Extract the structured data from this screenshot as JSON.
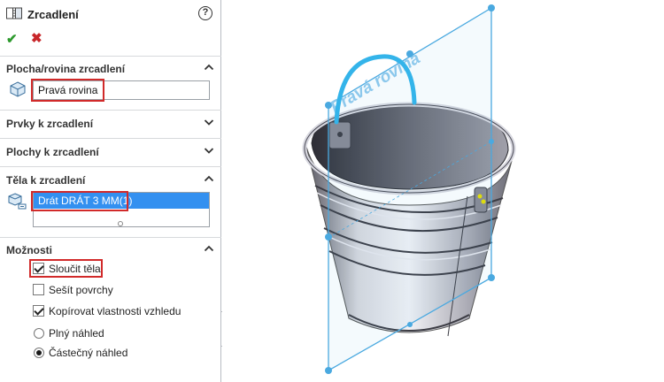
{
  "feature": {
    "title": "Zrcadlení",
    "help_glyph": "?",
    "ok_glyph": "✔",
    "cancel_glyph": "✖"
  },
  "sections": {
    "mirror_plane": {
      "label": "Plocha/rovina zrcadlení",
      "state": "expanded",
      "value": "Pravá rovina"
    },
    "features": {
      "label": "Prvky k zrcadlení",
      "state": "collapsed"
    },
    "faces": {
      "label": "Plochy k zrcadlení",
      "state": "collapsed"
    },
    "bodies": {
      "label": "Těla k zrcadlení",
      "state": "expanded",
      "items": [
        "Drát DRÁT 3 MM(1)"
      ]
    },
    "options": {
      "label": "Možnosti",
      "state": "expanded",
      "merge_bodies": {
        "label": "Sloučit těla",
        "checked": true
      },
      "knit_surfaces": {
        "label": "Sešít povrchy",
        "checked": false
      },
      "copy_appearance": {
        "label": "Kopírovat vlastnosti vzhledu",
        "checked": true
      },
      "full_preview": {
        "label": "Plný náhled",
        "selected": false
      },
      "partial_preview": {
        "label": "Částečný náhled",
        "selected": true
      }
    }
  },
  "viewport": {
    "plane_label": "Pravá rovina",
    "colors": {
      "plane": "#4aa9e0",
      "plane_label": "#8cc8ec",
      "highlight_handle": "#34b4ea",
      "bucket_body": "#9c9ca6",
      "bucket_dark": "#3c3c44",
      "selection_marker": "#e8e000"
    }
  },
  "highlight_color": "#d12a2a"
}
